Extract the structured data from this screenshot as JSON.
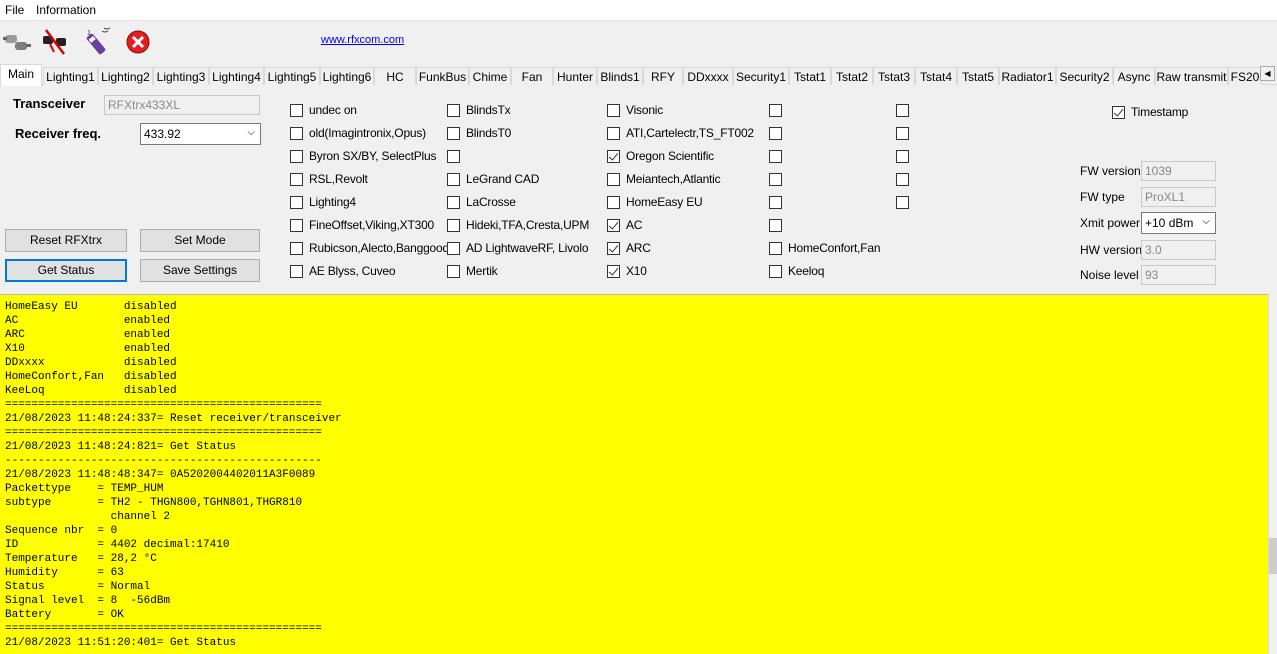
{
  "menu": {
    "file": "File",
    "information": "Information"
  },
  "toolbar": {
    "link": "www.rfxcom.com",
    "icons": [
      "connect-icon",
      "disconnect-icon",
      "transmit-icon",
      "close-icon"
    ]
  },
  "tabs": [
    "Main",
    "Lighting1",
    "Lighting2",
    "Lighting3",
    "Lighting4",
    "Lighting5",
    "Lighting6",
    "HC",
    "FunkBus",
    "Chime",
    "Fan",
    "Hunter",
    "Blinds1",
    "RFY",
    "DDxxxx",
    "Security1",
    "Tstat1",
    "Tstat2",
    "Tstat3",
    "Tstat4",
    "Tstat5",
    "Radiator1",
    "Security2",
    "Async",
    "Raw transmit",
    "FS20"
  ],
  "transceiver": {
    "label": "Transceiver",
    "value": "RFXtrx433XL"
  },
  "receiver": {
    "label": "Receiver freq.",
    "value": "433.92"
  },
  "buttons": {
    "reset": "Reset RFXtrx",
    "set_mode": "Set Mode",
    "get_status": "Get Status",
    "save": "Save Settings"
  },
  "checkboxes": {
    "col1": [
      {
        "label": "undec on",
        "checked": false
      },
      {
        "label": "old(Imagintronix,Opus)",
        "checked": false
      },
      {
        "label": "Byron SX/BY, SelectPlus",
        "checked": false
      },
      {
        "label": "RSL,Revolt",
        "checked": false
      },
      {
        "label": "Lighting4",
        "checked": false
      },
      {
        "label": "FineOffset,Viking,XT300",
        "checked": false
      },
      {
        "label": "Rubicson,Alecto,Banggood",
        "checked": false
      },
      {
        "label": "AE Blyss, Cuveo",
        "checked": false
      }
    ],
    "col2": [
      {
        "label": "BlindsTx",
        "checked": false
      },
      {
        "label": "BlindsT0",
        "checked": false
      },
      {
        "label": "",
        "checked": false
      },
      {
        "label": "LeGrand CAD",
        "checked": false
      },
      {
        "label": "LaCrosse",
        "checked": false
      },
      {
        "label": "Hideki,TFA,Cresta,UPM",
        "checked": false
      },
      {
        "label": "AD LightwaveRF, Livolo",
        "checked": false
      },
      {
        "label": "Mertik",
        "checked": false
      }
    ],
    "col3": [
      {
        "label": "Visonic",
        "checked": false
      },
      {
        "label": "ATI,Cartelectr,TS_FT002",
        "checked": false
      },
      {
        "label": "Oregon Scientific",
        "checked": true
      },
      {
        "label": "Meiantech,Atlantic",
        "checked": false
      },
      {
        "label": "HomeEasy EU",
        "checked": false
      },
      {
        "label": "AC",
        "checked": true
      },
      {
        "label": "ARC",
        "checked": true
      },
      {
        "label": "X10",
        "checked": true
      }
    ],
    "col4": [
      {
        "label": "",
        "checked": false
      },
      {
        "label": "",
        "checked": false
      },
      {
        "label": "",
        "checked": false
      },
      {
        "label": "",
        "checked": false
      },
      {
        "label": "",
        "checked": false
      },
      {
        "label": "",
        "checked": false
      },
      {
        "label": "HomeConfort,Fan",
        "checked": false
      },
      {
        "label": "Keeloq",
        "checked": false
      }
    ],
    "col5": [
      {
        "label": "",
        "checked": false
      },
      {
        "label": "",
        "checked": false
      },
      {
        "label": "",
        "checked": false
      },
      {
        "label": "",
        "checked": false
      },
      {
        "label": "",
        "checked": false
      }
    ],
    "timestamp": {
      "label": "Timestamp",
      "checked": true
    }
  },
  "info": {
    "fw_version": {
      "label": "FW version",
      "value": "1039"
    },
    "fw_type": {
      "label": "FW type",
      "value": "ProXL1"
    },
    "xmit_power": {
      "label": "Xmit power",
      "value": "+10 dBm"
    },
    "hw_version": {
      "label": "HW version",
      "value": "3.0"
    },
    "noise_level": {
      "label": "Noise level",
      "value": "93"
    }
  },
  "log": "HomeEasy EU       disabled\nAC                enabled\nARC               enabled\nX10               enabled\nDDxxxx            disabled\nHomeConfort,Fan   disabled\nKeeLoq            disabled\n================================================\n21/08/2023 11:48:24:337= Reset receiver/transceiver\n================================================\n21/08/2023 11:48:24:821= Get Status\n------------------------------------------------\n21/08/2023 11:48:48:347= 0A5202004402011A3F0089\nPackettype    = TEMP_HUM\nsubtype       = TH2 - THGN800,TGHN801,THGR810\n                channel 2\nSequence nbr  = 0\nID            = 4402 decimal:17410\nTemperature   = 28,2 °C\nHumidity      = 63\nStatus        = Normal\nSignal level  = 8  -56dBm\nBattery       = OK\n================================================\n21/08/2023 11:51:20:401= Get Status"
}
